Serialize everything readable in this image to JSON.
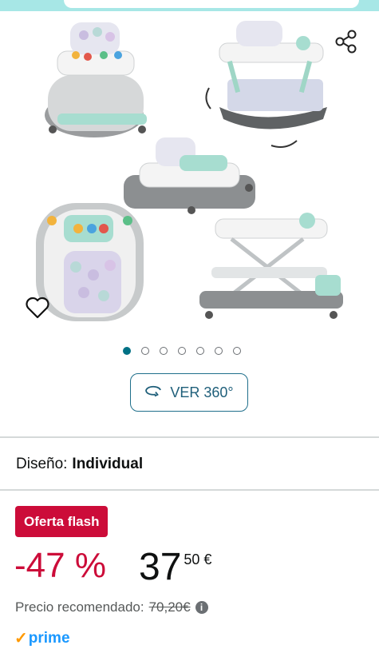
{
  "gallery": {
    "dots_total": 7,
    "active_index": 0
  },
  "view360": {
    "label": "VER 360°"
  },
  "design": {
    "label": "Diseño:",
    "value": "Individual"
  },
  "deal": {
    "badge": "Oferta flash"
  },
  "price": {
    "discount": "-47 %",
    "integer": "37",
    "decimal_currency": "50 €"
  },
  "rrp": {
    "label": "Precio recomendado:",
    "value": "70,20€"
  },
  "prime": {
    "label": "prime"
  },
  "colors": {
    "accent_teal": "#007185",
    "deal_red": "#cc0c39",
    "prime_blue": "#1a98ff",
    "prime_orange": "#ff9900"
  }
}
